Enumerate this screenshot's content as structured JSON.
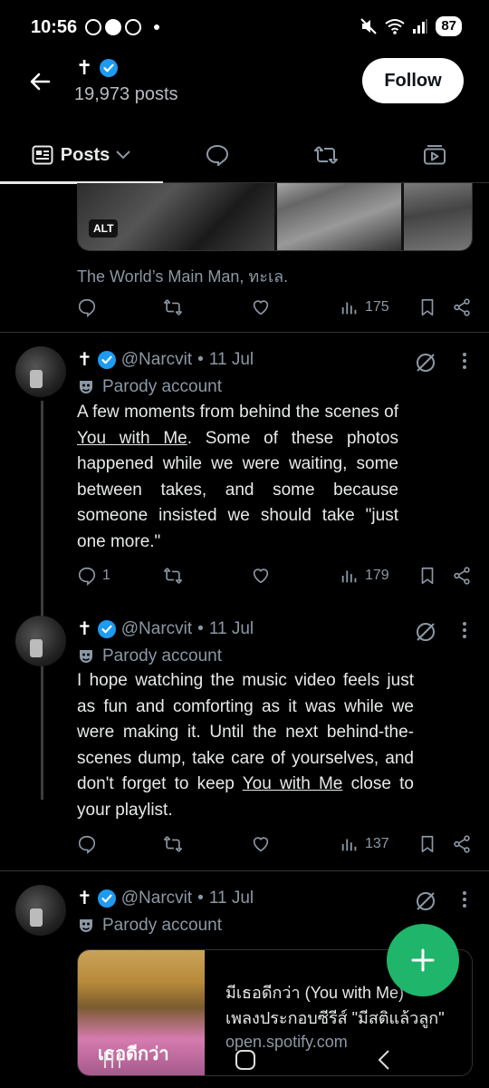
{
  "status_bar": {
    "time": "10:56",
    "battery": "87"
  },
  "header": {
    "name": "✝",
    "posts_count": "19,973 posts",
    "follow_label": "Follow"
  },
  "tabs": {
    "posts_label": "Posts"
  },
  "top_post": {
    "image_alt_badge": "ALT",
    "caption": "The World’s Main Man, ทะเล.",
    "views": "175"
  },
  "tweets": [
    {
      "name": "✝",
      "handle": "@Narcvit",
      "date": "11 Jul",
      "parody_label": "Parody account",
      "text_parts": [
        "A few moments from behind the scenes of ",
        "You with Me",
        ". Some of these photos happened while we were waiting, some between takes, and some because someone insisted we should take \"just one more.\""
      ],
      "replies": "1",
      "views": "179"
    },
    {
      "name": "✝",
      "handle": "@Narcvit",
      "date": "11 Jul",
      "parody_label": "Parody account",
      "text_parts": [
        "I hope watching the music video feels just as fun and comforting as it was while we were making it. Until the next behind-the-scenes dump, take care of yourselves, and don't forget to keep ",
        "You with Me",
        " close to your playlist."
      ],
      "views": "137"
    },
    {
      "name": "✝",
      "handle": "@Narcvit",
      "date": "11 Jul",
      "parody_label": "Parody account",
      "link_card": {
        "image_text": "เธอดีกว่า",
        "title": "มีเธอดีกว่า (You with Me)",
        "subtitle": "เพลงประกอบซีรีส์ \"มีสติแล้วลูก\"",
        "domain": "open.spotify.com"
      }
    }
  ],
  "colors": {
    "accent_blue": "#1d9bf0",
    "fab_green": "#1fb56b",
    "muted": "#8b98a5"
  }
}
